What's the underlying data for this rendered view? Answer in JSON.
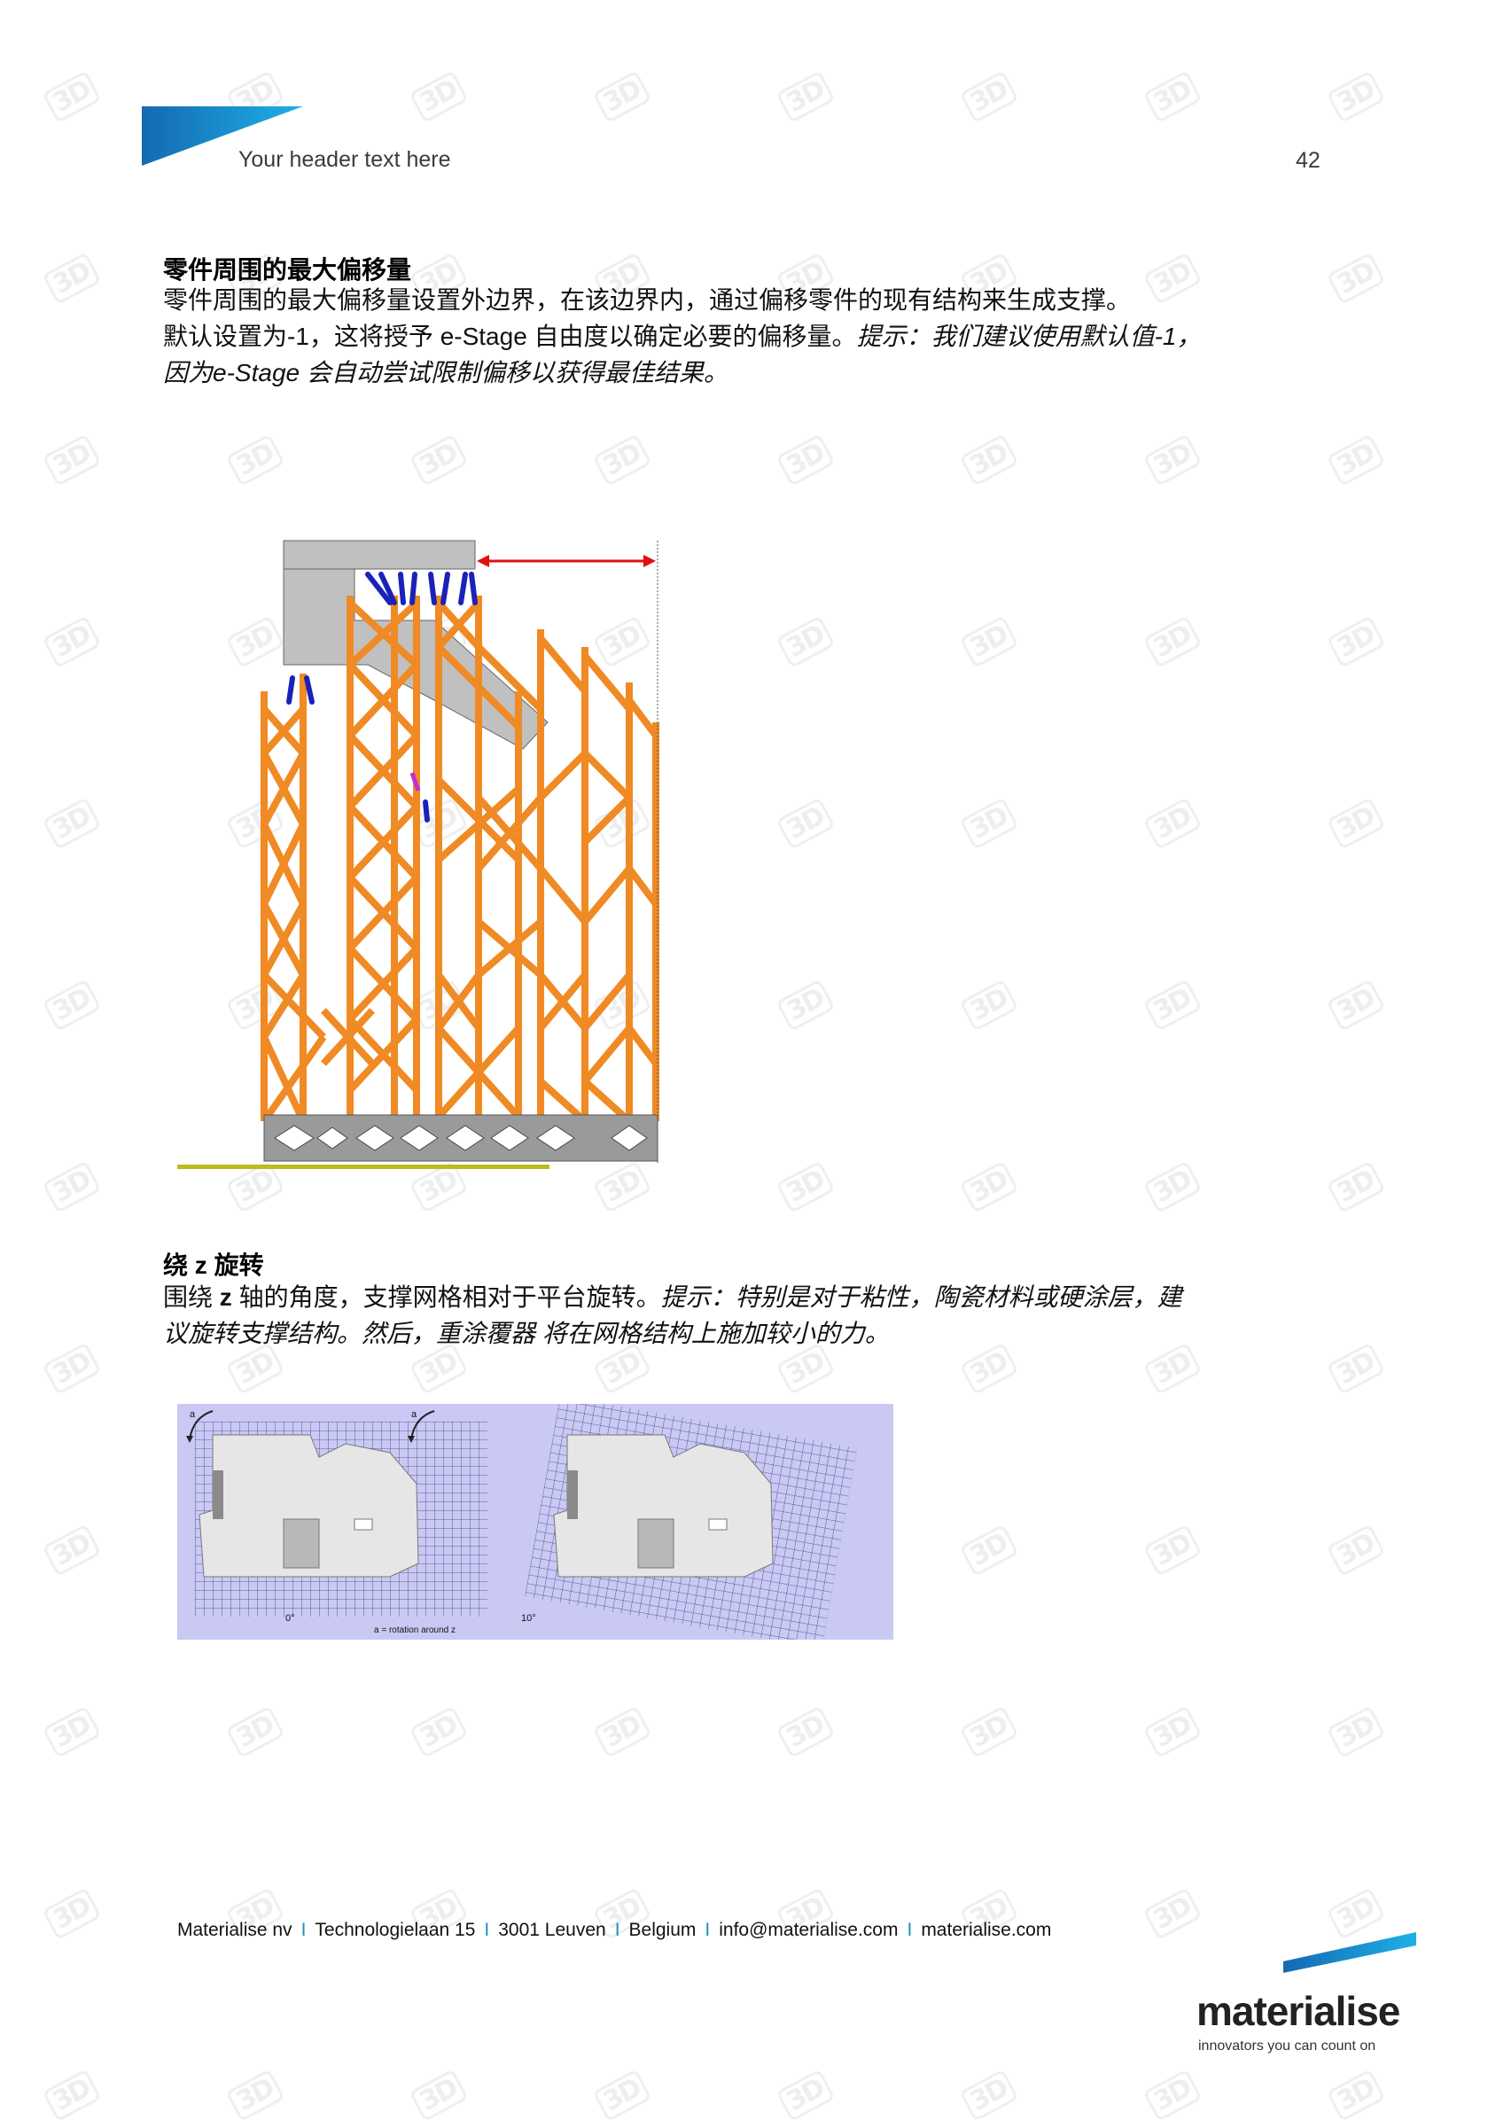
{
  "header": {
    "title": "Your header text here",
    "page_number": "42",
    "brand_color": "#1a8fd0"
  },
  "section_offset": {
    "title": "零件周围的最大偏移量",
    "line1": "零件周围的最大偏移量设置外边界，在该边界内，通过偏移零件的现有结构来生成支撑。",
    "line2_a": "默认设置为",
    "line2_b": "-1",
    "line2_c": "，这将授予 ",
    "line2_d": "e-Stage",
    "line2_e": " 自由度以确定必要的偏移量。",
    "tip_a": "提示：我们建议使用默认值",
    "tip_b": "-1",
    "tip_c": "，",
    "tip_d": "因为",
    "tip_e": "e-Stage",
    "tip_f": " 会自动尝试限制偏移以获得最佳结果。",
    "figure": {
      "description": "Side view of lattice support structure with offset arrow",
      "support_color": "#f08a24",
      "part_color": "#c0c0c0",
      "connector_color": "#1a22b8",
      "arrow_color": "#e01010",
      "platform_color": "#bcbc1a"
    }
  },
  "section_rotation": {
    "title_a": "绕",
    "title_b": " z ",
    "title_c": "旋转",
    "line1_a": "围绕",
    "line1_b": " z ",
    "line1_c": "轴的角度，支撑网格相对于平台旋转。",
    "tip_a": "提示：特别是对于粘性，陶瓷材料或硬涂层，建",
    "tip_b": "议旋转支撑结构。然后，重涂覆器 将在网格结构上施加较小的力。",
    "figure": {
      "label_a_left": "a",
      "label_a_right": "a",
      "angle_left": "0°",
      "angle_right": "10°",
      "caption": "a = rotation around z",
      "background_color": "#c9c9f4"
    }
  },
  "footer": {
    "company": "Materialise nv",
    "street": "Technologielaan 15",
    "city": "3001 Leuven",
    "country": "Belgium",
    "email": "info@materialise.com",
    "website": "materialise.com",
    "separator": "I",
    "logo_word": "materialise",
    "logo_tagline": "innovators you can count on"
  }
}
